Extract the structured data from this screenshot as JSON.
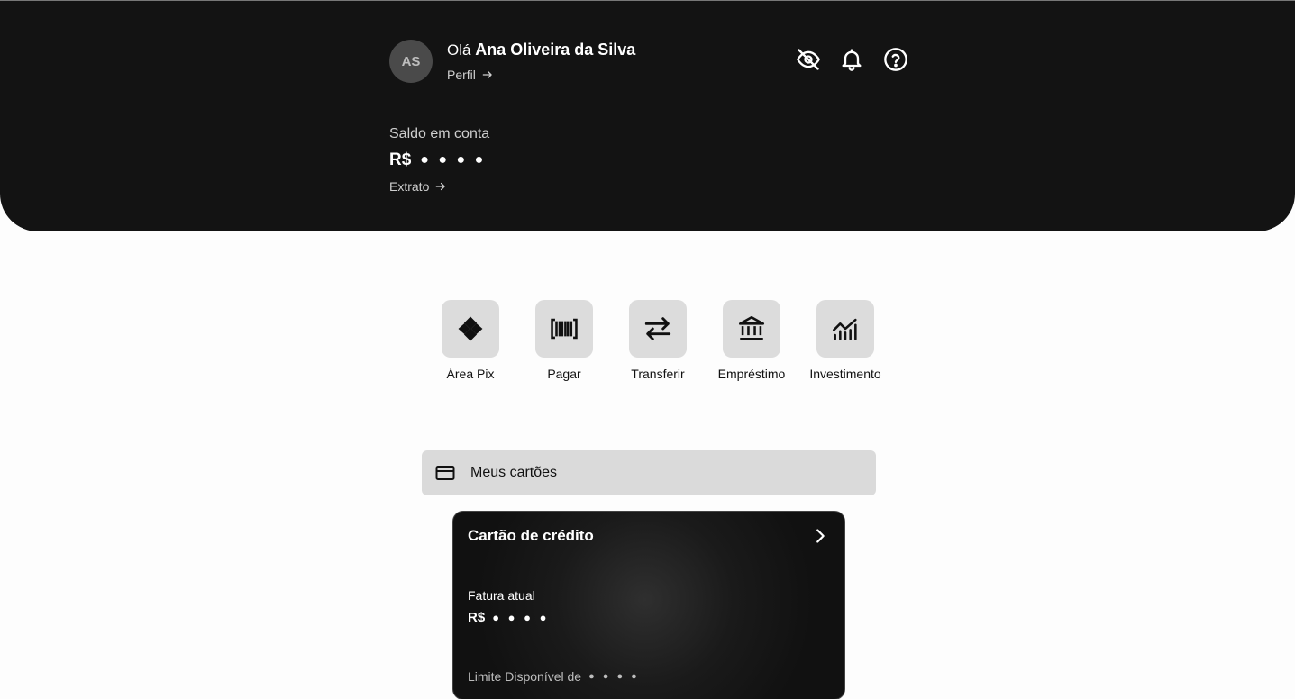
{
  "header": {
    "avatar_initials": "AS",
    "greeting_prefix": "Olá",
    "user_name": "Ana Oliveira da Silva",
    "profile_link": "Perfil",
    "balance_label": "Saldo em conta",
    "currency": "R$",
    "balance_hidden": "● ● ● ●",
    "statement_link": "Extrato",
    "icons": [
      "eye-off-icon",
      "bell-icon",
      "help-icon"
    ]
  },
  "actions": [
    {
      "label": "Área Pix",
      "icon": "pix-icon"
    },
    {
      "label": "Pagar",
      "icon": "barcode-icon"
    },
    {
      "label": "Transferir",
      "icon": "transfer-icon"
    },
    {
      "label": "Empréstimo",
      "icon": "bank-icon"
    },
    {
      "label": "Investimento",
      "icon": "chart-icon"
    }
  ],
  "cards_section": {
    "label": "Meus cartões",
    "icon": "credit-card-icon"
  },
  "credit_card": {
    "title": "Cartão de crédito",
    "invoice_label": "Fatura atual",
    "currency": "R$",
    "invoice_hidden": "● ● ● ●",
    "limit_label": "Limite Disponível de",
    "limit_hidden": "● ● ● ●"
  },
  "colors": {
    "header_bg": "#131313",
    "page_bg": "#fdfdfd",
    "tile_bg": "#dcdcdc",
    "cards_bar_bg": "#dadada"
  }
}
